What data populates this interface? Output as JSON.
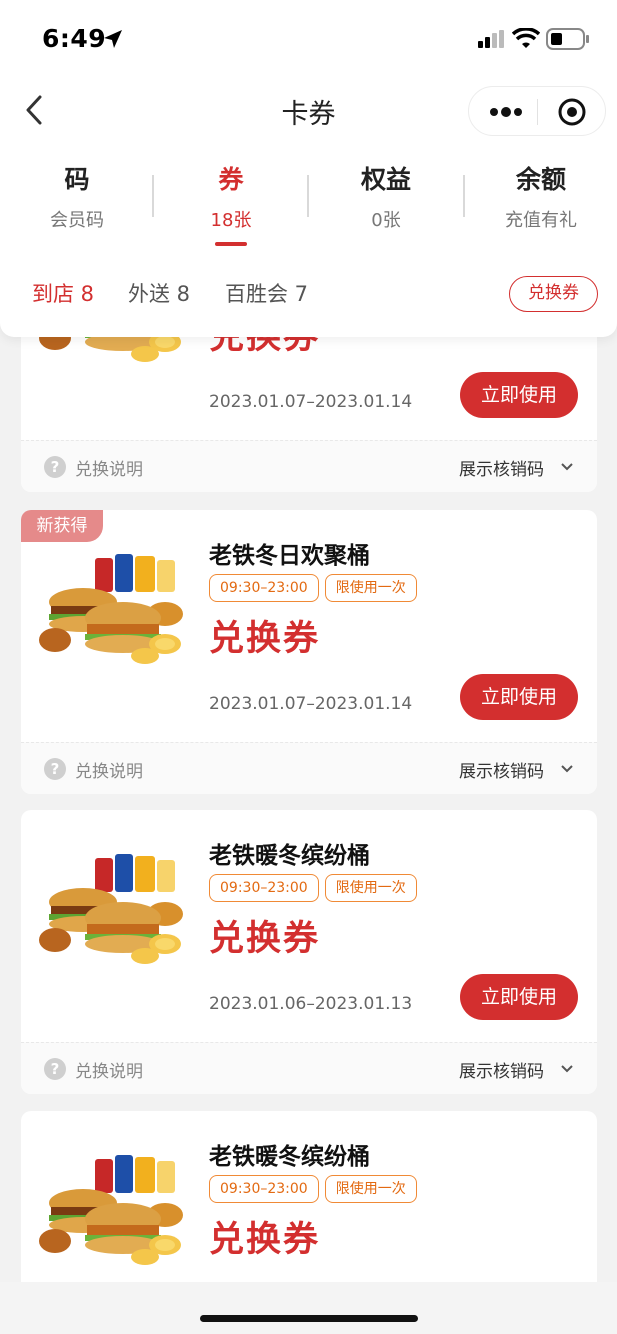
{
  "status": {
    "time": "6:49"
  },
  "nav": {
    "title": "卡券"
  },
  "top_tabs": [
    {
      "title": "码",
      "sub": "会员码"
    },
    {
      "title": "券",
      "sub": "18张"
    },
    {
      "title": "权益",
      "sub": "0张"
    },
    {
      "title": "余额",
      "sub": "充值有礼"
    }
  ],
  "sub_tabs": [
    {
      "label": "到店 8"
    },
    {
      "label": "外送 8"
    },
    {
      "label": "百胜会 7"
    }
  ],
  "redeem_button": "兑换券",
  "cards": [
    {
      "badge": "",
      "name": "",
      "tags": [],
      "type": "兑换券",
      "validity": "2023.01.07–2023.01.14",
      "use_label": "立即使用",
      "help_label": "兑换说明",
      "show_label": "展示核销码"
    },
    {
      "badge": "新获得",
      "name": "老铁冬日欢聚桶",
      "tags": [
        "09:30–23:00",
        "限使用一次"
      ],
      "type": "兑换券",
      "validity": "2023.01.07–2023.01.14",
      "use_label": "立即使用",
      "help_label": "兑换说明",
      "show_label": "展示核销码"
    },
    {
      "badge": "",
      "name": "老铁暖冬缤纷桶",
      "tags": [
        "09:30–23:00",
        "限使用一次"
      ],
      "type": "兑换券",
      "validity": "2023.01.06–2023.01.13",
      "use_label": "立即使用",
      "help_label": "兑换说明",
      "show_label": "展示核销码"
    },
    {
      "badge": "",
      "name": "老铁暖冬缤纷桶",
      "tags": [
        "09:30–23:00",
        "限使用一次"
      ],
      "type": "兑换券",
      "validity": "",
      "use_label": "",
      "help_label": "",
      "show_label": ""
    }
  ],
  "colors": {
    "accent": "#d32f2f",
    "tag": "#e36a12",
    "badge": "#e58a8a"
  }
}
